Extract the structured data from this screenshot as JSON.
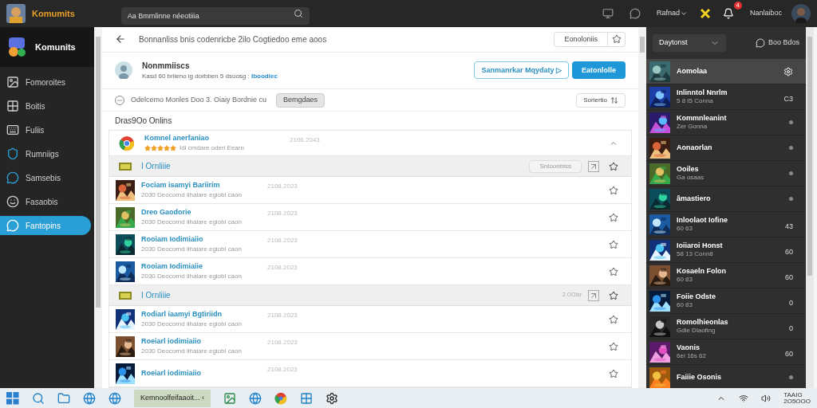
{
  "topbar": {
    "brand": "Komumits",
    "search": {
      "placeholder": "Aa Bmrnlinne néeotiiia"
    },
    "account": "Rafnad",
    "username": "Nanlaiboc",
    "notifications": "4"
  },
  "sidebar": {
    "title": "Komunits",
    "items": [
      {
        "label": "Fomoroites",
        "selected": false
      },
      {
        "label": "Boitis",
        "selected": false
      },
      {
        "label": "Fuliis",
        "selected": false
      },
      {
        "label": "Rumniigs",
        "selected": false
      },
      {
        "label": "Samsebis",
        "selected": false
      },
      {
        "label": "Fasaobis",
        "selected": false
      },
      {
        "label": "Fantopins",
        "selected": true
      }
    ]
  },
  "main": {
    "title": "Bonnanliss bnis codenricbe 2ilo Cogtiedoo eme aoos",
    "header_button": "Eonoloniis",
    "profile": {
      "name": "Nonmmiiscs",
      "text": "Kasd 60 briieno ig dorbben 5 dsoosg : ",
      "link": "Iboodlec",
      "outline_button": "Sanmanrkar Mqydaty ▷",
      "primary_button": "Eatonlolle"
    },
    "notice": {
      "text": "Odelcemo Monles Doo 3. Oiaiy Bordnie cu",
      "button": "Bemgdaes",
      "sort_button": "Soriertio"
    },
    "section_title": "Dras9Oo Onlins",
    "featured": {
      "title": "Komnel anerfaniao",
      "stars": 5,
      "subtitle": "Idl cmdare oderi Eearn",
      "date": "2106.2043",
      "expanded": true
    },
    "groups": [
      {
        "title": "I Ornliiie",
        "action": "Sntoonbiss",
        "items": [
          {
            "title": "Fociam isamyi Bariirim",
            "subtitle": "2030 Deocornd ilhaiare egiobl caon",
            "date": "2108.2023"
          },
          {
            "title": "Dreo Gaodorie",
            "subtitle": "2030 Deocornd ilhaiare egiobl caon",
            "date": "2108.2023"
          },
          {
            "title": "Rooiam Iodimiaiio",
            "subtitle": "2030 Deocornd ilhaiare egiobl caon",
            "date": "2108.2023"
          },
          {
            "title": "Rooiam Iodimiaiie",
            "subtitle": "2030 Deocornd ilhaiare egiobl caon",
            "date": "2108.2023"
          }
        ]
      },
      {
        "title": "I Ornliiie",
        "action": "2 OOisr",
        "items": [
          {
            "title": "Rodiarl iaamyi Bgtiriidn",
            "subtitle": "2030 Deocornd ilhaiare egiobl caon",
            "date": "2108.2023"
          },
          {
            "title": "Roeiarl iodimiaiio",
            "subtitle": "2030 Deocornd ilhaiare egiobl caon",
            "date": "2108.2023"
          },
          {
            "title": "Roeiarl iodimiaiio",
            "date": "2108.2023"
          }
        ]
      }
    ]
  },
  "panel": {
    "dropdown": "Daytonst",
    "action": "Boo Bdos",
    "items": [
      {
        "title": "Aomolaa",
        "selected": true,
        "kind": "icon"
      },
      {
        "title": "Inlinntol Nnrlm",
        "subtitle": "5 8 t5 Conna",
        "selected": false,
        "kind": "count",
        "badge": "C3"
      },
      {
        "title": "Kommnleanint",
        "subtitle": "Zer Gonna",
        "selected": false,
        "kind": "dot"
      },
      {
        "title": "Aonaorlan",
        "selected": false,
        "kind": "dot"
      },
      {
        "title": "Ooiles",
        "subtitle": "Ga osaas",
        "selected": false,
        "kind": "dot"
      },
      {
        "title": "âmastiero",
        "selected": false,
        "kind": "dot"
      },
      {
        "title": "Inloolaot Iofine",
        "subtitle": "60 63",
        "selected": false,
        "kind": "count",
        "badge": "43"
      },
      {
        "title": "Ioiiaroi Honst",
        "subtitle": "58 13 Conn8",
        "selected": false,
        "kind": "count",
        "badge": "60"
      },
      {
        "title": "Kosaeln Folon",
        "subtitle": "60 83",
        "selected": false,
        "kind": "count",
        "badge": "60"
      },
      {
        "title": "Foiie Odste",
        "subtitle": "60 83",
        "selected": false,
        "kind": "count",
        "badge": "0"
      },
      {
        "title": "Romolhieonlas",
        "subtitle": "Gdle Dlaofing",
        "selected": false,
        "kind": "count",
        "badge": "0"
      },
      {
        "title": "Vaonis",
        "subtitle": "6el 16s 62",
        "selected": false,
        "kind": "count",
        "badge": "60"
      },
      {
        "title": "Faiiie Osonis",
        "selected": false,
        "kind": "dot"
      }
    ]
  },
  "taskbar": {
    "active_app": "Kemnoolfeifaaoit... ‹",
    "clock": "TAAIG",
    "date": "2O5OOO"
  }
}
